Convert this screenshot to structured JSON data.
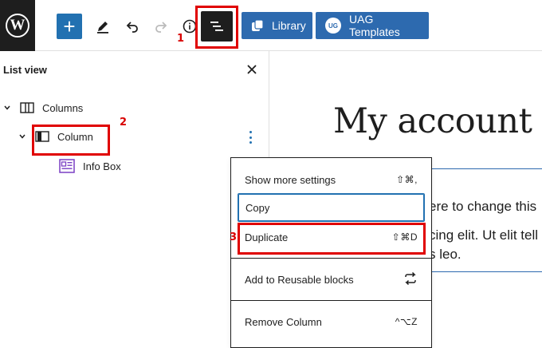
{
  "toolbar": {
    "logo_letter": "W",
    "add_block_symbol": "+",
    "library_label": "Library",
    "uag_label": "UAG Templates",
    "uag_badge": "UG",
    "icons": [
      "wordpress-logo",
      "plus-icon",
      "pencil-icon",
      "undo-icon",
      "redo-icon",
      "info-icon",
      "list-view-icon",
      "library-icon",
      "uag-icon"
    ]
  },
  "sidebar": {
    "title": "List view",
    "tree": [
      {
        "label": "Columns",
        "icon": "columns-icon",
        "expanded": true
      },
      {
        "label": "Column",
        "icon": "column-icon",
        "expanded": true
      },
      {
        "label": "Info Box",
        "icon": "info-box-icon"
      }
    ]
  },
  "content": {
    "heading": "My account",
    "paragraph_lines": [
      "ere to change this",
      "cing elit. Ut elit tell",
      "s leo."
    ]
  },
  "menu": {
    "items": [
      {
        "label": "Show more settings",
        "shortcut": "⇧⌘,"
      },
      {
        "label": "Copy",
        "shortcut": ""
      },
      {
        "label": "Duplicate",
        "shortcut": "⇧⌘D"
      },
      {
        "label": "Add to Reusable blocks",
        "shortcut_icon": "reusable-icon"
      },
      {
        "label": "Remove Column",
        "shortcut": "^⌥Z"
      }
    ]
  },
  "annotations": {
    "step_1": "1",
    "step_2": "2",
    "step_3": "3"
  },
  "colors": {
    "accent_blue": "#2d6aaf",
    "annotation_red": "#e00000",
    "dark": "#1e1e1e"
  }
}
